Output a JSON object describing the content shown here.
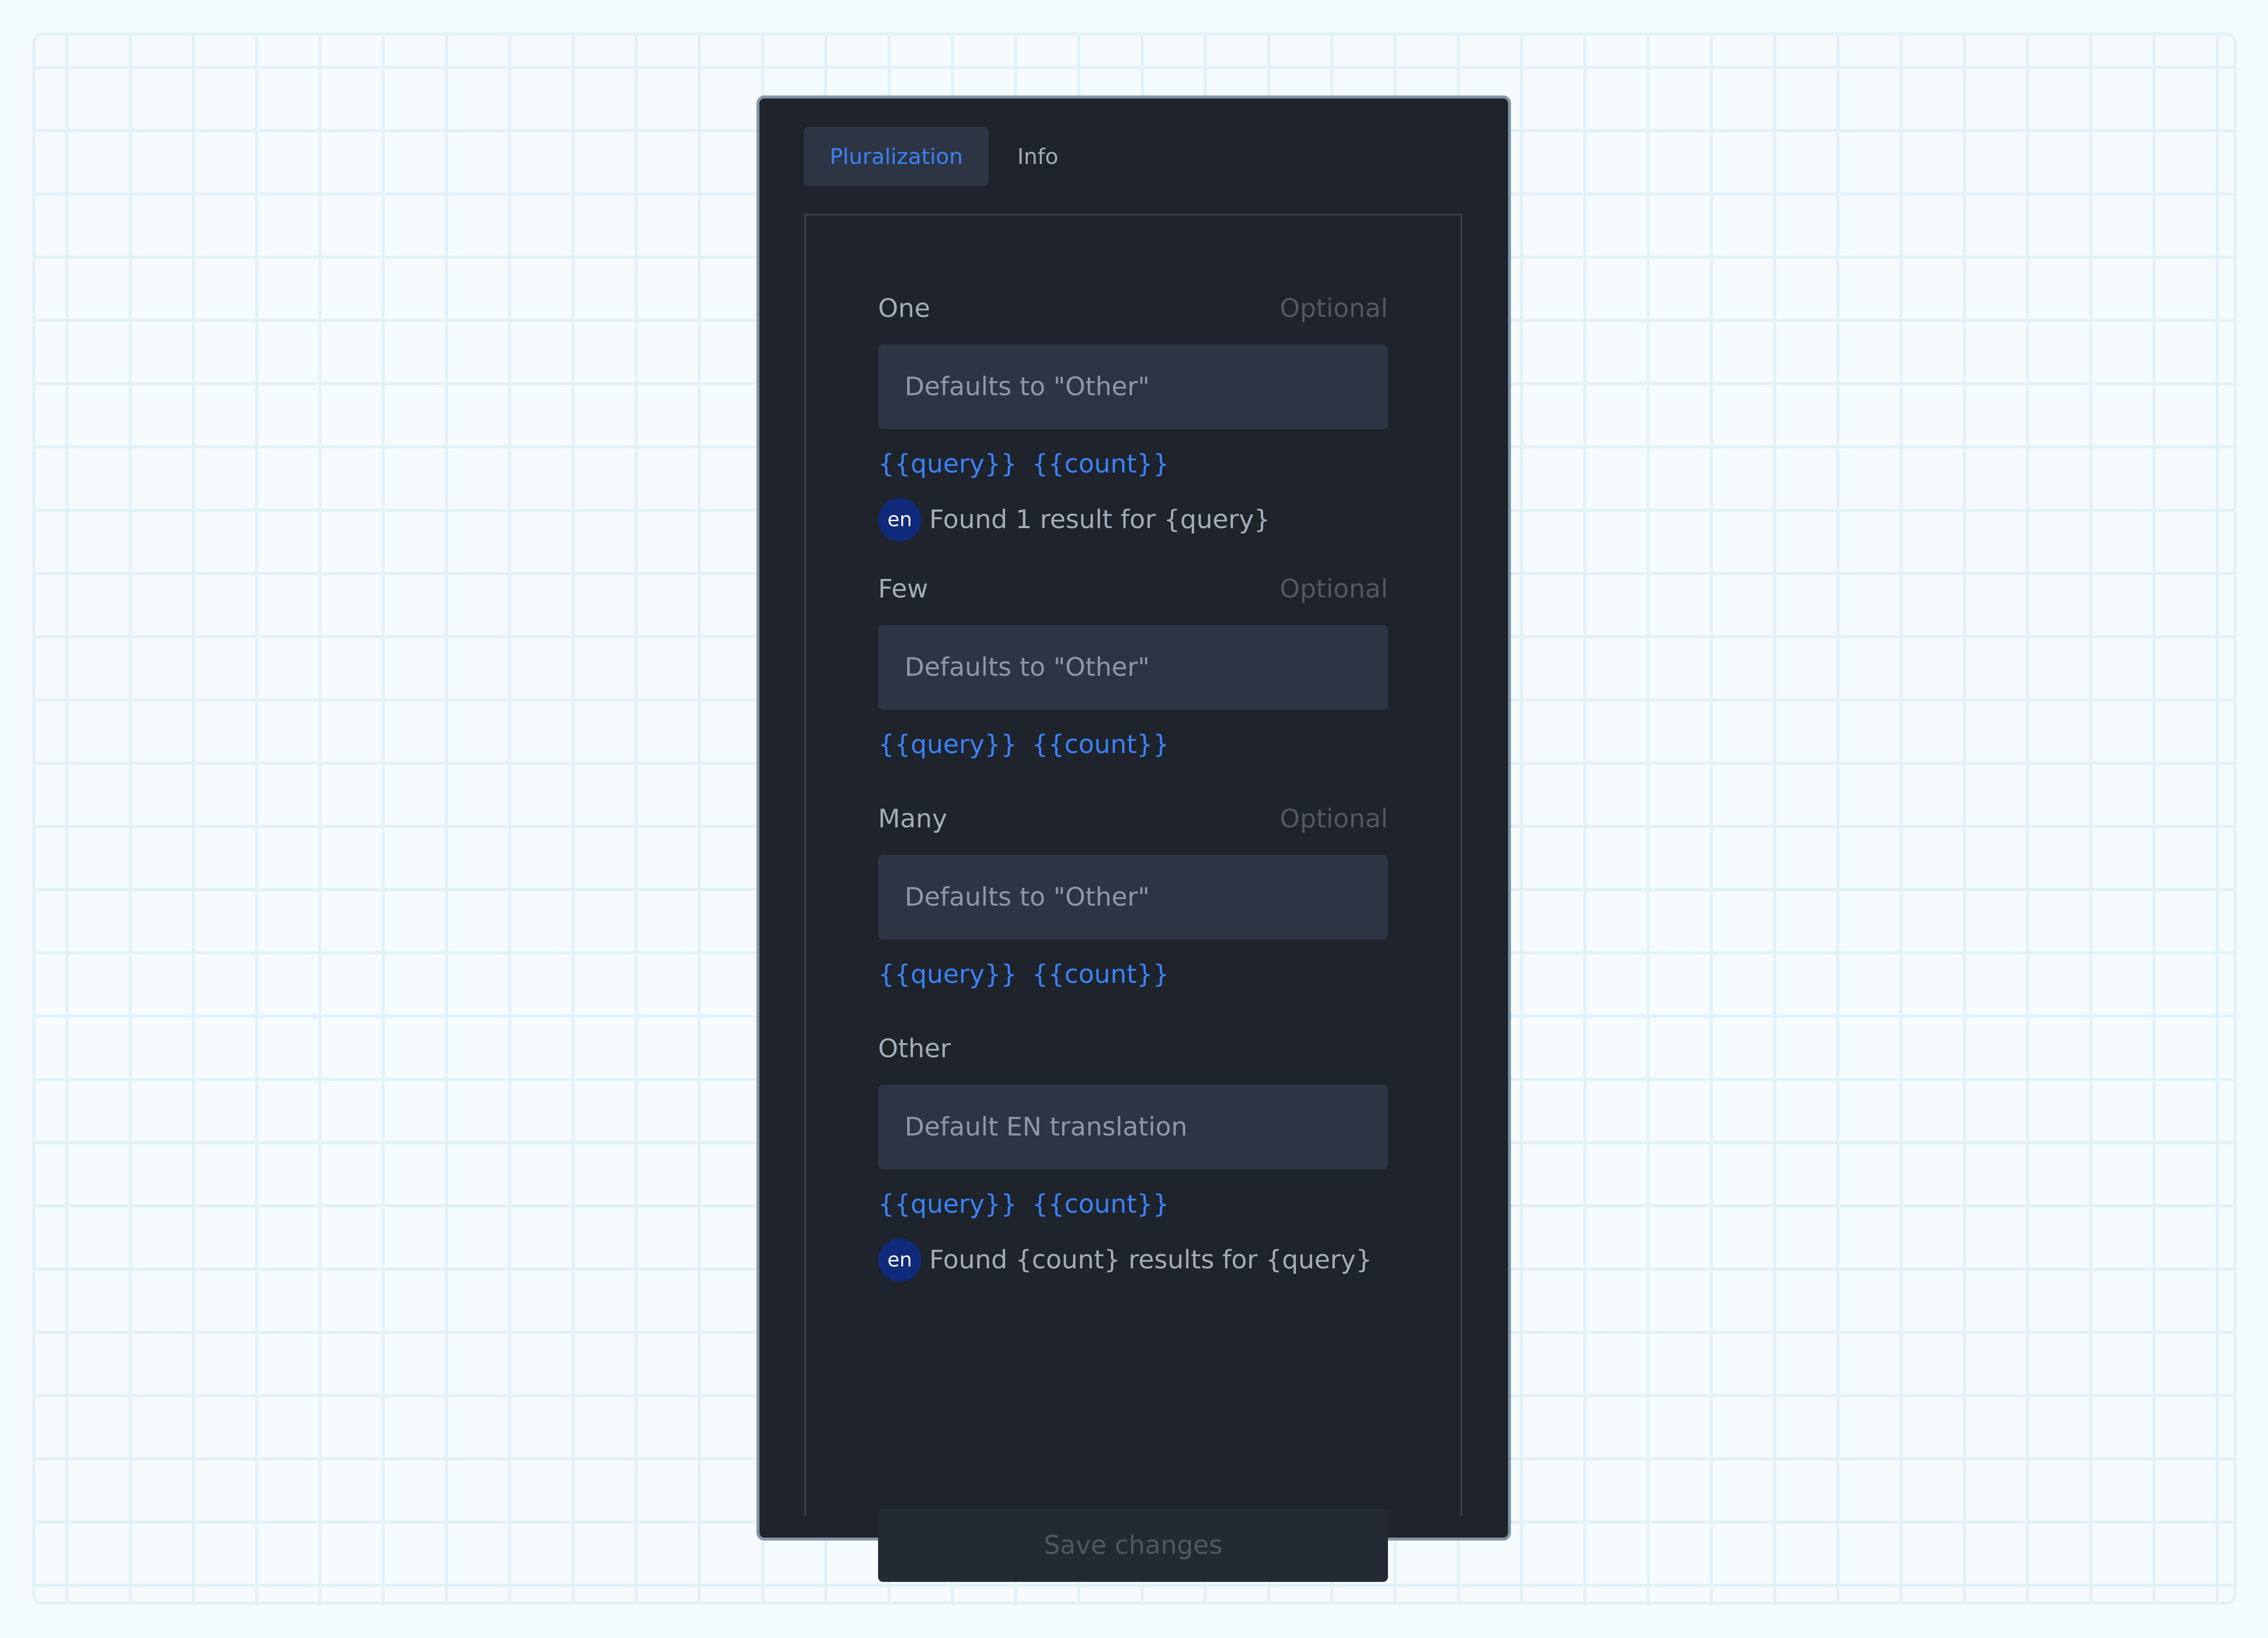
{
  "tabs": {
    "pluralization": "Pluralization",
    "info": "Info"
  },
  "sections": [
    {
      "label": "One",
      "optional": "Optional",
      "placeholder": "Defaults to \"Other\"",
      "vars": [
        "{{query}}",
        "{{count}}"
      ],
      "preview": {
        "lang": "en",
        "text": "Found 1 result for {query}"
      }
    },
    {
      "label": "Few",
      "optional": "Optional",
      "placeholder": "Defaults to \"Other\"",
      "vars": [
        "{{query}}",
        "{{count}}"
      ]
    },
    {
      "label": "Many",
      "optional": "Optional",
      "placeholder": "Defaults to \"Other\"",
      "vars": [
        "{{query}}",
        "{{count}}"
      ]
    },
    {
      "label": "Other",
      "placeholder": "Default EN translation",
      "vars": [
        "{{query}}",
        "{{count}}"
      ],
      "preview": {
        "lang": "en",
        "text": "Found {count} results for {query}"
      }
    }
  ],
  "save_button": "Save changes",
  "colors": {
    "accent": "#3b82f6",
    "panel_background": "#1e232c",
    "input_background": "#2d3544",
    "language_badge": "#0f2a7a"
  }
}
